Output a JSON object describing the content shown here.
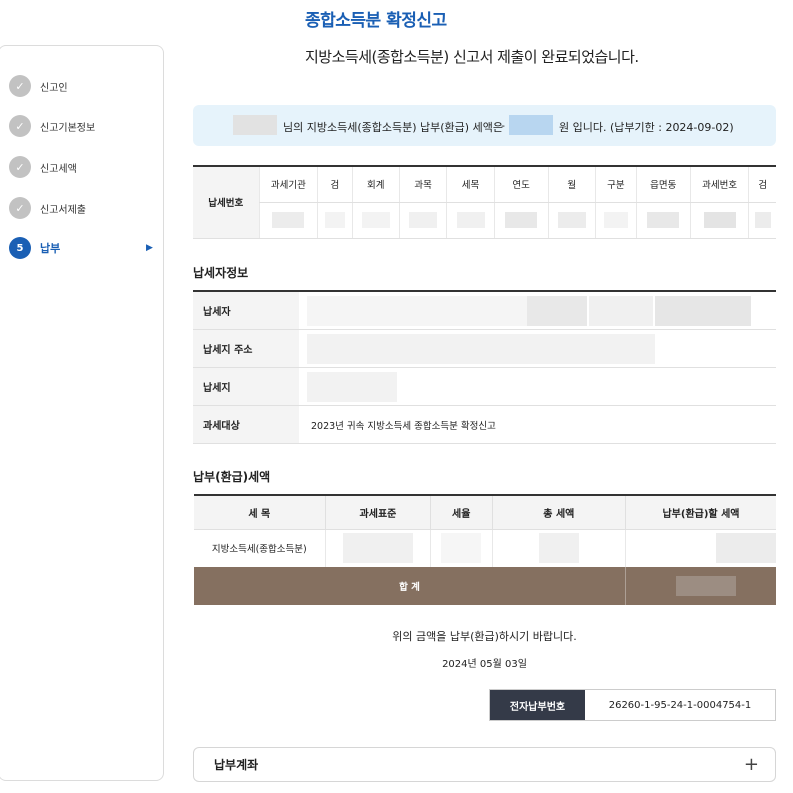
{
  "page": {
    "title": "종합소득분 확정신고",
    "subtitle": "지방소득세(종합소득분) 신고서 제출이 완료되었습니다."
  },
  "sidebar": {
    "steps": [
      {
        "label": "신고인",
        "state": "done"
      },
      {
        "label": "신고기본정보",
        "state": "done"
      },
      {
        "label": "신고세액",
        "state": "done"
      },
      {
        "label": "신고서제출",
        "state": "done"
      },
      {
        "label": "납부",
        "number": "5",
        "state": "active"
      }
    ],
    "check_icon": "check-icon",
    "arrow_icon": "arrow-right-icon"
  },
  "notice": {
    "part1": "님의 지방소득세(종합소득분) 납부(환급) 세액은",
    "part2": "-",
    "part3": "원 입니다. (납부기한 : 2024-09-02)"
  },
  "tax_number_table": {
    "row_header": "납세번호",
    "columns": [
      "과세기관",
      "검",
      "회계",
      "과목",
      "세목",
      "연도",
      "월",
      "구분",
      "읍면동",
      "과세번호",
      "검"
    ]
  },
  "taxpayer_section": {
    "title": "납세자정보",
    "rows": [
      {
        "label": "납세자",
        "value": ""
      },
      {
        "label": "납세지 주소",
        "value": ""
      },
      {
        "label": "납세지",
        "value": ""
      },
      {
        "label": "과세대상",
        "value": "2023년 귀속 지방소득세 종합소득분 확정신고"
      }
    ]
  },
  "payment_section": {
    "title": "납부(환급)세액",
    "columns": [
      "세 목",
      "과세표준",
      "세율",
      "총 세액",
      "납부(환급)할 세액"
    ],
    "row_label": "지방소득세(종합소득분)",
    "total_label": "합 계"
  },
  "footer": {
    "message": "위의 금액을 납부(환급)하시기 바랍니다.",
    "date": "2024년 05월 03일",
    "epay_label": "전자납부번호",
    "epay_number": "26260-1-95-24-1-0004754-1"
  },
  "accordion": {
    "title": "납부계좌",
    "toggle": "+"
  },
  "colors": {
    "accent": "#1a5fb4",
    "notice_bg": "#e6f3fb",
    "total_row": "#857060",
    "epay_label_bg": "#343a48"
  }
}
